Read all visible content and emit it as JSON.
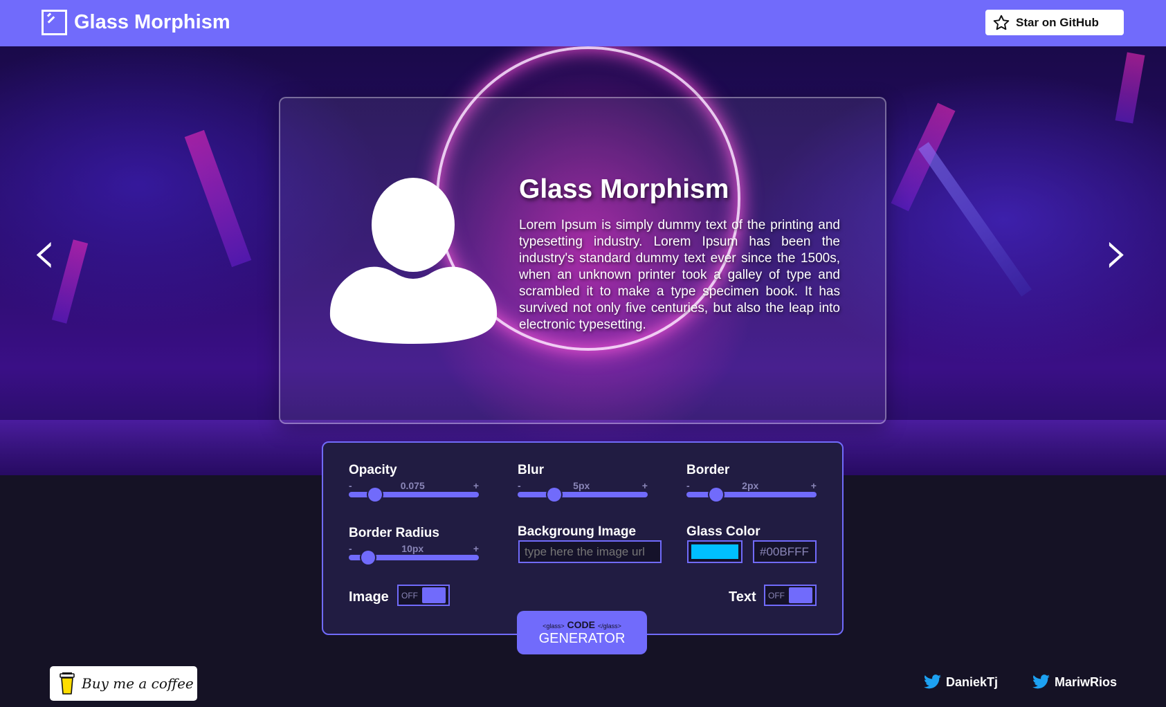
{
  "nav": {
    "title": "Glass Morphism",
    "github_label": "Star on GitHub"
  },
  "card": {
    "title": "Glass Morphism",
    "text": "Lorem Ipsum is simply dummy text of the printing and typesetting industry. Lorem Ipsum has been the industry's standard dummy text ever since the 1500s, when an unknown printer took a galley of type and scrambled it to make a type specimen book. It has survived not only five centuries, but also the leap into electronic typesetting."
  },
  "controls": {
    "opacity": {
      "label": "Opacity",
      "minus": "-",
      "value": "0.075",
      "plus": "+",
      "level": 0.2
    },
    "blur": {
      "label": "Blur",
      "minus": "-",
      "value": "5px",
      "plus": "+",
      "level": 0.28
    },
    "border": {
      "label": "Border",
      "minus": "-",
      "value": "2px",
      "plus": "+",
      "level": 0.23
    },
    "radius": {
      "label": "Border Radius",
      "minus": "-",
      "value": "10px",
      "plus": "+",
      "level": 0.15
    },
    "bg_image": {
      "label": "Backgroung Image",
      "placeholder": "type here the image url"
    },
    "glass_color": {
      "label": "Glass Color",
      "swatch": "#00BFFF",
      "hex": "#00BFFF"
    },
    "image_toggle": {
      "label": "Image",
      "state": "OFF"
    },
    "text_toggle": {
      "label": "Text",
      "state": "OFF"
    }
  },
  "generator": {
    "tag_open": "<glass>",
    "code": "CODE",
    "tag_close": "</glass>",
    "label": "GENERATOR"
  },
  "footer": {
    "coffee_label": "Buy me a coffee",
    "twitter": [
      "DaniekTj",
      "MariwRios"
    ]
  },
  "colors": {
    "accent": "#716bfb",
    "panel": "#211c42",
    "page": "#151225"
  },
  "icons": {
    "github": "star-icon",
    "twitter": "twitter-icon",
    "prev": "chevron-left-icon",
    "next": "chevron-right-icon"
  }
}
